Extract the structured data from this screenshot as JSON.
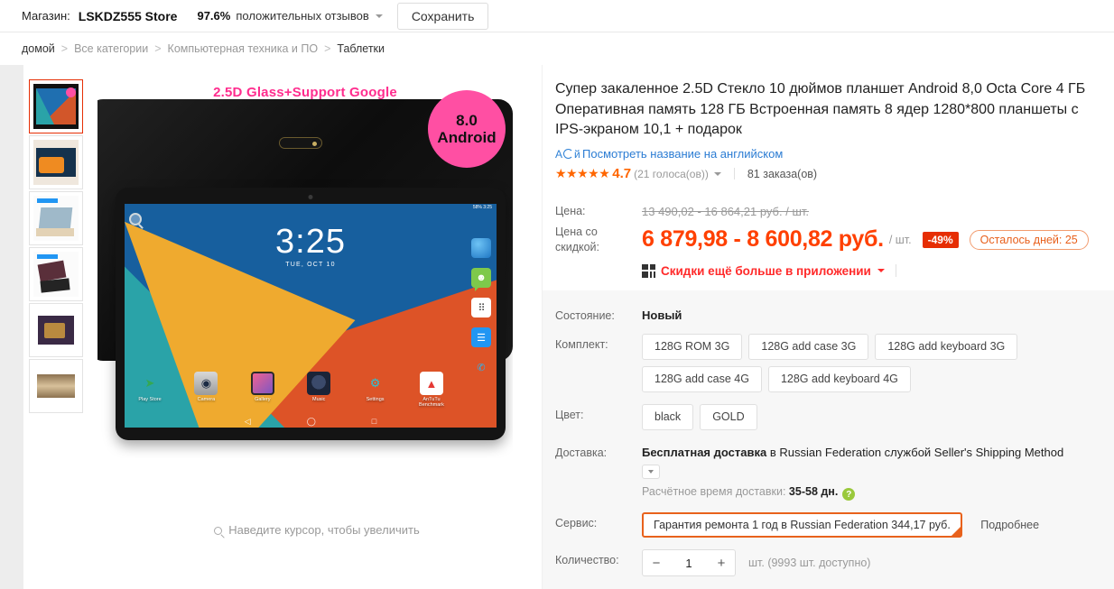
{
  "shop_bar": {
    "label": "Магазин:",
    "name": "LSKDZ555 Store",
    "percent": "97.6%",
    "feedback": "положительных отзывов",
    "save_label": "Сохранить"
  },
  "breadcrumb": {
    "items": [
      "домой",
      "Все категории",
      "Компьютерная техника и ПО",
      "Таблетки"
    ],
    "separator": ">"
  },
  "gallery": {
    "hero_banner": "2.5D Glass+Support Google",
    "android_badge_version": "8.0",
    "android_badge_name": "Android",
    "zoom_hint": "Наведите курсор, чтобы увеличить",
    "screen": {
      "clock": "3:25",
      "date": "TUE, OCT 10",
      "status_left": "",
      "status_right": "58%  3:25",
      "apps": [
        {
          "name": "Play Store",
          "glyph": "▶"
        },
        {
          "name": "Camera",
          "glyph": "◉"
        },
        {
          "name": "Gallery",
          "glyph": ""
        },
        {
          "name": "Music",
          "glyph": ""
        },
        {
          "name": "Settings",
          "glyph": "⚙"
        },
        {
          "name": "AnTuTu Benchmark",
          "glyph": "▲"
        }
      ],
      "nav": [
        "◁",
        "◯",
        "□"
      ]
    },
    "thumbnails": [
      {
        "alt": "tablet-front-home-screen"
      },
      {
        "alt": "tablet-racing-car-screen"
      },
      {
        "alt": "tablet-in-gold-case"
      },
      {
        "alt": "tablet-with-keyboard-case"
      },
      {
        "alt": "tablet-spec-sheet"
      },
      {
        "alt": "tablet-gold-back"
      }
    ]
  },
  "product": {
    "title": "Супер закаленное 2.5D Стекло 10 дюймов планшет Android 8,0 Octa Core 4 ГБ Оперативная память 128 ГБ Встроенная память 8 ядер 1280*800 планшеты с IPS-экраном 10,1 + подарок",
    "translate_link": "Посмотреть название на английском",
    "stars": "★★★★★",
    "rating": "4.7",
    "votes": "(21 голоса(ов))",
    "orders": "81 заказа(ов)"
  },
  "price": {
    "label_old": "Цена:",
    "old_value": "13 490,02 - 16 864,21 руб. / шт.",
    "label_new": "Цена со скидкой:",
    "new_value": "6 879,98 - 8 600,82 руб.",
    "unit": "/ шт.",
    "discount_badge": "-49%",
    "days_badge": "Осталось дней: 25",
    "app_discount": "Скидки ещё больше в приложении",
    "accent_color": "#ff4000",
    "badge_color": "#e62e04"
  },
  "attributes": {
    "condition_label": "Состояние:",
    "condition_value": "Новый",
    "kit_label": "Комплект:",
    "kit_options": [
      "128G ROM 3G",
      "128G add case 3G",
      "128G add keyboard 3G",
      "128G add case 4G",
      "128G add keyboard 4G"
    ],
    "color_label": "Цвет:",
    "color_options": [
      "black",
      "GOLD"
    ],
    "shipping_label": "Доставка:",
    "shipping_bold": "Бесплатная доставка",
    "shipping_rest": " в Russian Federation службой Seller's Shipping Method",
    "eta_label": "Расчётное время доставки:",
    "eta_value": "35-58 дн.",
    "service_label": "Сервис:",
    "service_value": "Гарантия ремонта 1 год в Russian Federation 344,17 руб.",
    "service_more": "Подробнее",
    "quantity_label": "Количество:",
    "quantity_value": "1",
    "quantity_minus": "−",
    "quantity_plus": "+",
    "stock": "шт. (9993 шт. доступно)"
  }
}
